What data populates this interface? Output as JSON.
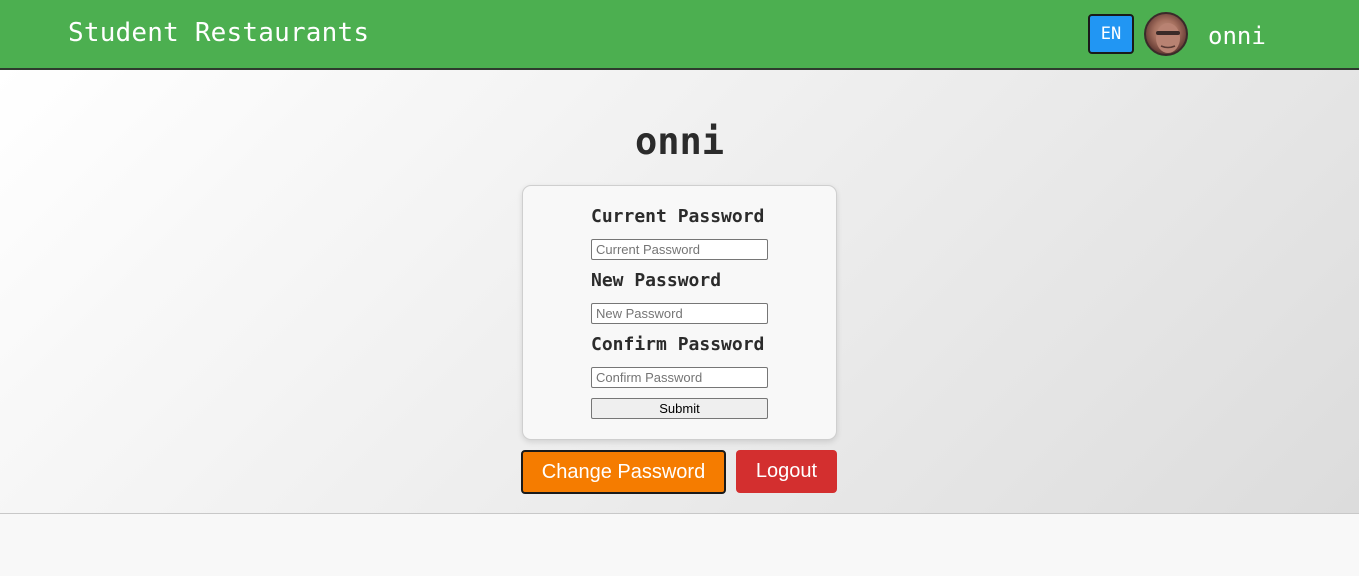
{
  "header": {
    "title": "Student Restaurants",
    "language_button": "EN",
    "username": "onni"
  },
  "profile": {
    "name": "onni"
  },
  "password_form": {
    "current_label": "Current Password",
    "current_placeholder": "Current Password",
    "current_value": "",
    "new_label": "New Password",
    "new_placeholder": "New Password",
    "new_value": "",
    "confirm_label": "Confirm Password",
    "confirm_placeholder": "Confirm Password",
    "confirm_value": "",
    "submit_label": "Submit"
  },
  "actions": {
    "change_password_label": "Change Password",
    "logout_label": "Logout"
  },
  "colors": {
    "header_bg": "#4caf50",
    "language_button_bg": "#2196f3",
    "change_password_bg": "#f57c00",
    "logout_bg": "#d32f2f"
  }
}
